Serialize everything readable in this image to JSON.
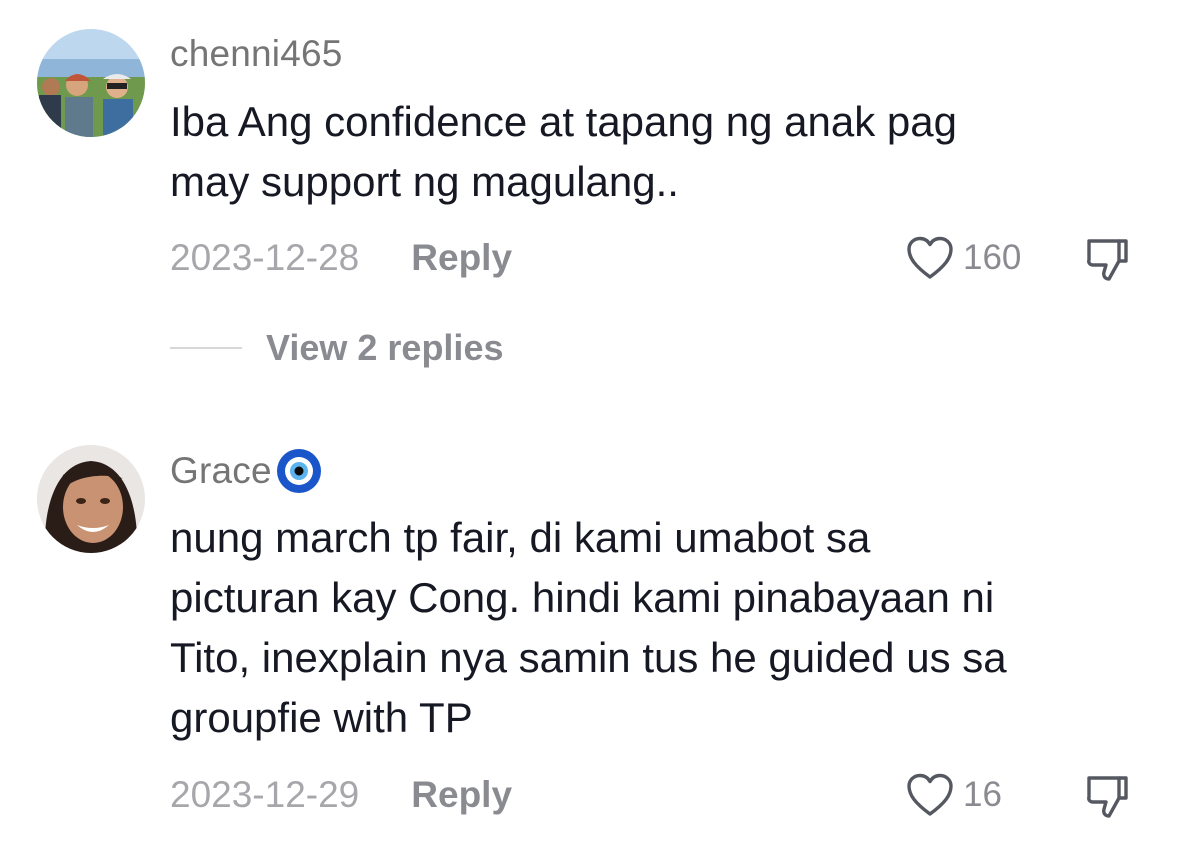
{
  "comments": [
    {
      "username": "chenni465",
      "text_lines": [
        "Iba Ang confidence at tapang ng anak pag",
        "may support ng magulang.."
      ],
      "date": "2023-12-28",
      "reply_label": "Reply",
      "likes": "160",
      "view_replies_label": "View 2 replies",
      "icons": {
        "like": "heart-icon",
        "dislike": "thumbs-down-icon"
      }
    },
    {
      "username": "Grace",
      "username_badge": "nazar-eye-icon",
      "text_lines": [
        "nung march tp fair, di kami umabot sa",
        "picturan kay Cong. hindi kami pinabayaan ni",
        "Tito, inexplain nya samin tus he guided us sa",
        "groupfie with TP"
      ],
      "date": "2023-12-29",
      "reply_label": "Reply",
      "likes": "16",
      "icons": {
        "like": "heart-icon",
        "dislike": "thumbs-down-icon"
      }
    }
  ],
  "colors": {
    "text_primary": "#161823",
    "text_secondary": "#757575",
    "meta": "#a7a7ab",
    "action": "#8a8b91",
    "badge_blue": "#1a56c9"
  }
}
